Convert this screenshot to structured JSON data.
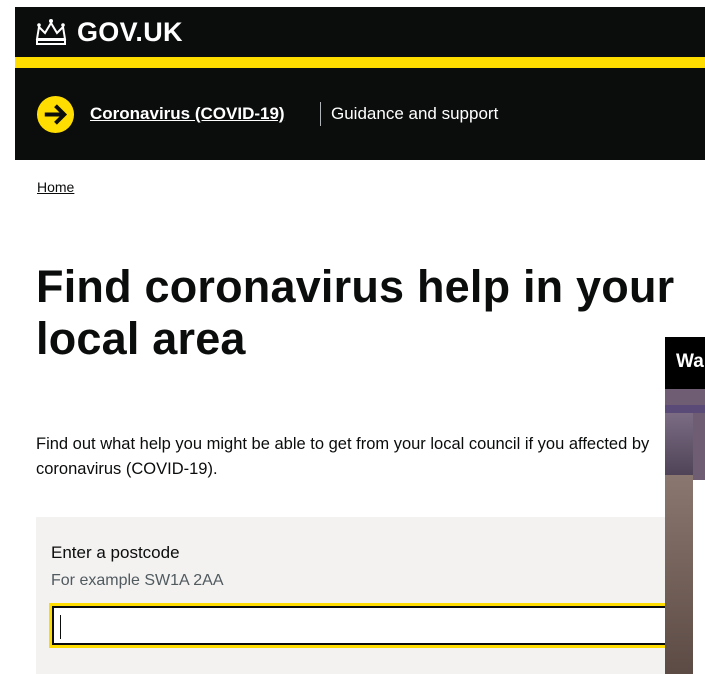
{
  "header": {
    "logo_text": "GOV.UK",
    "logo_icon": "crown-icon"
  },
  "banner": {
    "icon": "arrow-right-circle-icon",
    "link_text": "Coronavirus (COVID-19)",
    "text": "Guidance and support",
    "accent": "#ffdd00"
  },
  "breadcrumb": {
    "home": "Home"
  },
  "main": {
    "title": "Find coronavirus help in your local area",
    "lede": "Find out what help you might be able to get from your local council if you affected by coronavirus (COVID-19)."
  },
  "form": {
    "label": "Enter a postcode",
    "hint": "For example SW1A 2AA",
    "value": ""
  },
  "overlay": {
    "title_fragment": "Wa"
  }
}
